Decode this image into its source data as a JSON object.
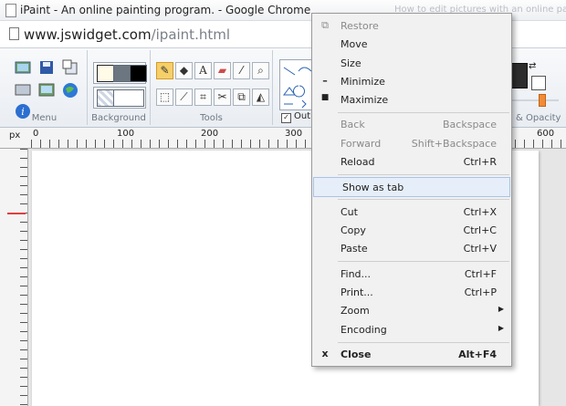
{
  "window": {
    "title": "iPaint - An online painting program. - Google Chrome",
    "ghost_title": "How to edit pictures with an online pai..."
  },
  "address_bar": {
    "url_domain": "www.jswidget.com",
    "url_path": "/ipaint.html"
  },
  "ribbon": {
    "groups": [
      "Menu",
      "Background",
      "Tools"
    ],
    "outline_label": "Out",
    "opacity_label": "& Opacity"
  },
  "ruler": {
    "unit": "px",
    "labels": [
      "0",
      "100",
      "200",
      "300",
      "600"
    ]
  },
  "context_menu": {
    "items": [
      {
        "label": "Restore",
        "shortcut": "",
        "icon": "restore-icon",
        "enabled": false
      },
      {
        "label": "Move",
        "shortcut": "",
        "icon": "",
        "enabled": true
      },
      {
        "label": "Size",
        "shortcut": "",
        "icon": "",
        "enabled": true
      },
      {
        "label": "Minimize",
        "shortcut": "",
        "icon": "minimize-icon",
        "enabled": true
      },
      {
        "label": "Maximize",
        "shortcut": "",
        "icon": "maximize-icon",
        "enabled": true
      },
      {
        "label": "Back",
        "shortcut": "Backspace",
        "enabled": false
      },
      {
        "label": "Forward",
        "shortcut": "Shift+Backspace",
        "enabled": false
      },
      {
        "label": "Reload",
        "shortcut": "Ctrl+R",
        "enabled": true
      },
      {
        "label": "Show as tab",
        "shortcut": "",
        "enabled": true,
        "highlighted": true
      },
      {
        "label": "Cut",
        "shortcut": "Ctrl+X",
        "enabled": true
      },
      {
        "label": "Copy",
        "shortcut": "Ctrl+C",
        "enabled": true
      },
      {
        "label": "Paste",
        "shortcut": "Ctrl+V",
        "enabled": true
      },
      {
        "label": "Find...",
        "shortcut": "Ctrl+F",
        "enabled": true
      },
      {
        "label": "Print...",
        "shortcut": "Ctrl+P",
        "enabled": true
      },
      {
        "label": "Zoom",
        "shortcut": "",
        "submenu": true,
        "enabled": true
      },
      {
        "label": "Encoding",
        "shortcut": "",
        "submenu": true,
        "enabled": true
      },
      {
        "label": "Close",
        "shortcut": "Alt+F4",
        "icon": "close-icon",
        "enabled": true,
        "bold": true
      }
    ],
    "close_icon_glyph": "x"
  }
}
